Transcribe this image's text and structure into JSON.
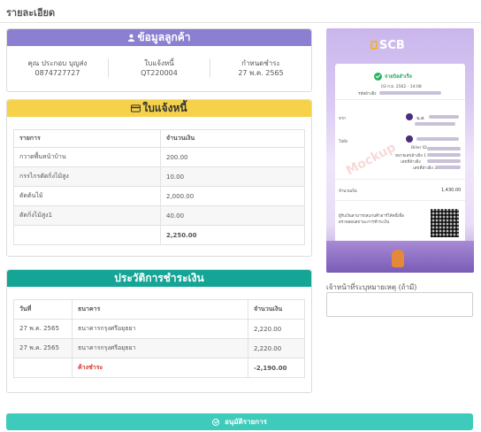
{
  "page": {
    "title": "รายละเอียด"
  },
  "customer": {
    "header": "ข้อมูลลูกค้า",
    "name": "คุณ ประกอบ บุญส่ง",
    "phone": "0874727727",
    "invoice_label": "ใบแจ้งหนี้",
    "invoice_no": "QT220004",
    "due_label": "กำหนดชำระ",
    "due_date": "27 พ.ค. 2565"
  },
  "invoice": {
    "header": "ใบแจ้งหนี้",
    "columns": [
      "รายการ",
      "จำนวนเงิน"
    ],
    "rows": [
      {
        "item": "กวาดพื้นหน้าบ้าน",
        "amount": "200.00"
      },
      {
        "item": "กรรไกรตัดกิ่งไม้สูง",
        "amount": "10.00"
      },
      {
        "item": "ตัดต้นไม้",
        "amount": "2,000.00"
      },
      {
        "item": "ตัดกิ่งไม้สูง1",
        "amount": "40.00"
      }
    ],
    "total": "2,250.00"
  },
  "payments": {
    "header": "ประวัติการชำระเงิน",
    "columns": [
      "วันที่",
      "ธนาคาร",
      "จำนวนเงิน"
    ],
    "rows": [
      {
        "date": "27 พ.ค. 2565",
        "bank": "ธนาคารกรุงศรีอยุธยา",
        "amount": "2,220.00"
      },
      {
        "date": "27 พ.ค. 2565",
        "bank": "ธนาคารกรุงศรีอยุธยา",
        "amount": "2,220.00"
      }
    ],
    "outstanding_label": "ค้างชำระ",
    "outstanding_amount": "-2,190.00"
  },
  "slip": {
    "bank": "SCB",
    "status": "จ่ายบิลสำเร็จ",
    "datetime": "03 ก.ย. 2562 - 14:08",
    "ref_label": "รหัสอ้างอิง",
    "from_label": "จาก",
    "from_name": "น.ส.",
    "to_label": "ไปยัง",
    "biller_label": "Biller ID",
    "ref1_label": "หมายเลขอ้างอิง 1",
    "ref2_label": "เลขที่อ้างอิง",
    "ref3_label": "เลขที่อ้างอิง 3",
    "amount_label": "จำนวนเงิน",
    "amount": "1,430.00",
    "qr_note": "ผู้รับเงินสามารถสแกนคิวอาร์โค้ดนี้เพื่อ",
    "qr_note2": "ตรวจสอบสถานะการชำระเงิน",
    "watermark": "Mockup"
  },
  "note": {
    "label": "เจ้าหน้าที่ระบุหมายเหตุ (ถ้ามี)",
    "placeholder": ""
  },
  "approve_button": {
    "label": "อนุมัติรายการ"
  }
}
